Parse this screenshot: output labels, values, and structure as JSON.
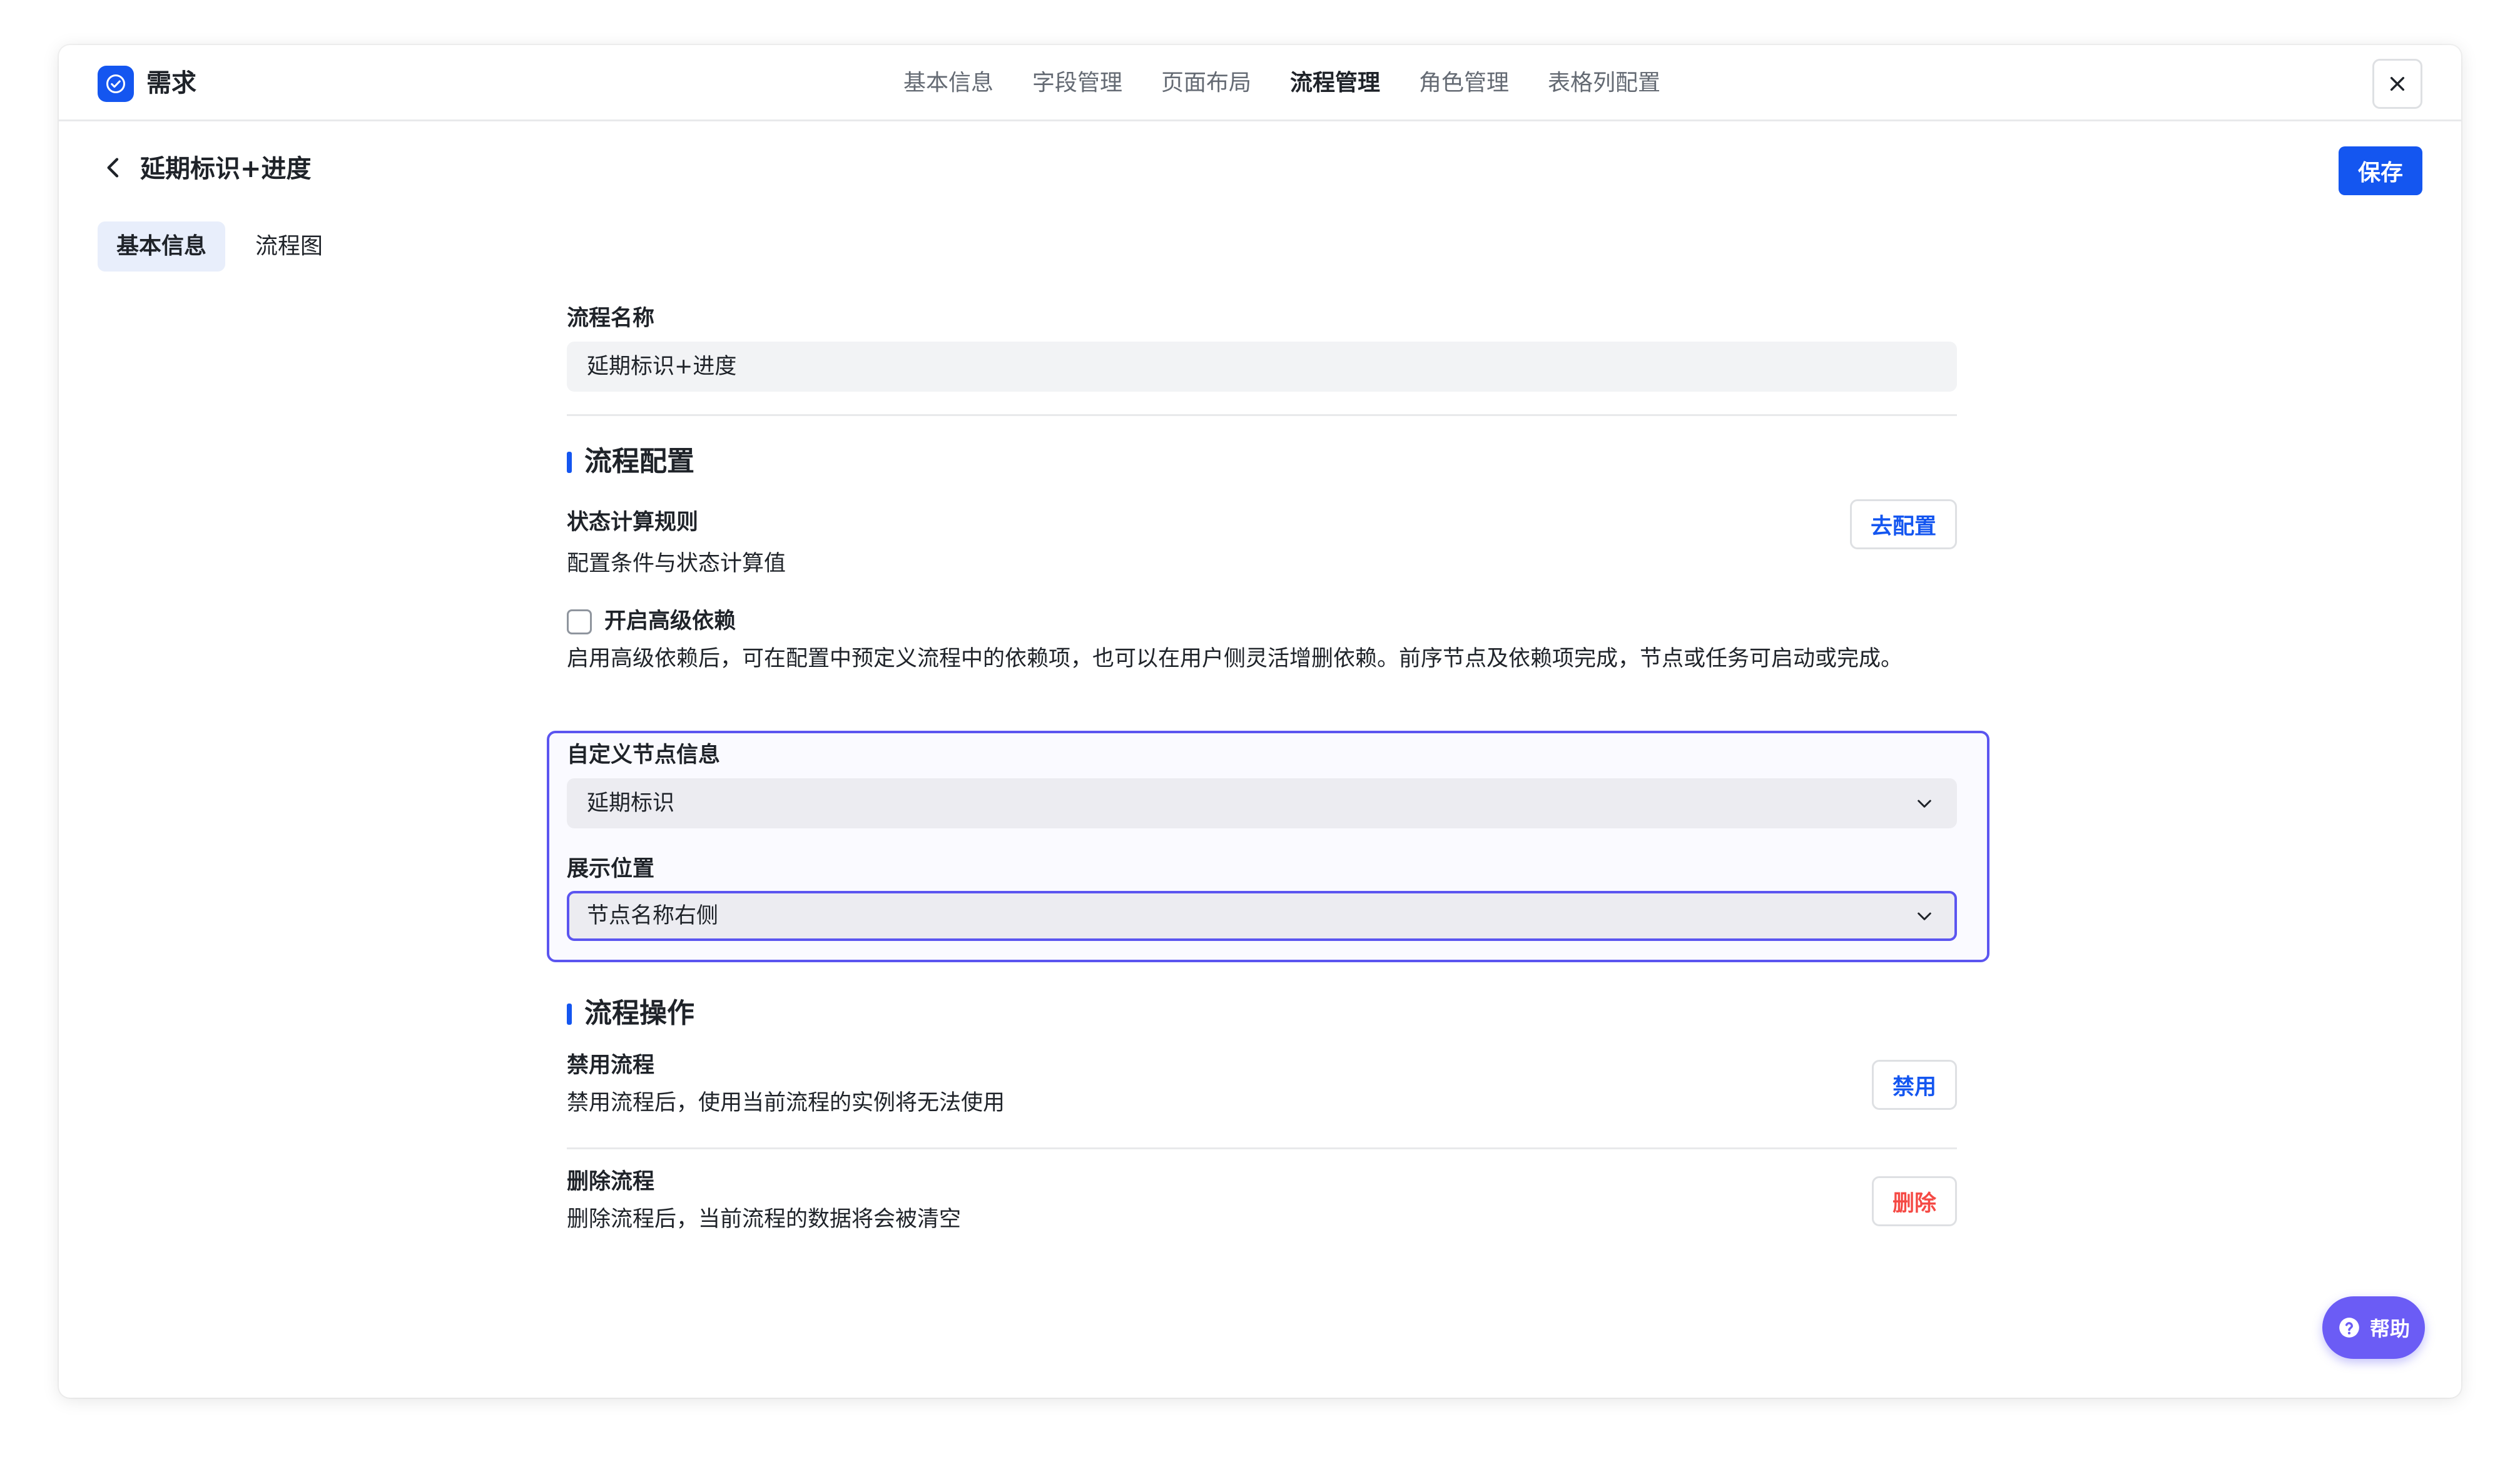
{
  "app": {
    "title": "需求"
  },
  "nav": {
    "tabs": [
      {
        "label": "基本信息",
        "active": false
      },
      {
        "label": "字段管理",
        "active": false
      },
      {
        "label": "页面布局",
        "active": false
      },
      {
        "label": "流程管理",
        "active": true
      },
      {
        "label": "角色管理",
        "active": false
      },
      {
        "label": "表格列配置",
        "active": false
      }
    ]
  },
  "header": {
    "title": "延期标识+进度",
    "save_label": "保存"
  },
  "sub_tabs": [
    {
      "label": "基本信息",
      "active": true
    },
    {
      "label": "流程图",
      "active": false
    }
  ],
  "form": {
    "flow_name_label": "流程名称",
    "flow_name_value": "延期标识+进度",
    "config_section": "流程配置",
    "state_rule_label": "状态计算规则",
    "state_rule_desc": "配置条件与状态计算值",
    "state_rule_button": "去配置",
    "advanced_dep_label": "开启高级依赖",
    "advanced_dep_checked": false,
    "advanced_dep_desc": "启用高级依赖后，可在配置中预定义流程中的依赖项，也可以在用户侧灵活增删依赖。前序节点及依赖项完成，节点或任务可启动或完成。",
    "custom_node_label": "自定义节点信息",
    "custom_node_value": "延期标识",
    "display_pos_label": "展示位置",
    "display_pos_value": "节点名称右侧",
    "ops_section": "流程操作",
    "disable_label": "禁用流程",
    "disable_desc": "禁用流程后，使用当前流程的实例将无法使用",
    "disable_button": "禁用",
    "delete_label": "删除流程",
    "delete_desc": "删除流程后，当前流程的数据将会被清空",
    "delete_button": "删除"
  },
  "help": {
    "label": "帮助"
  },
  "colors": {
    "primary": "#1456f0",
    "accent": "#5b55f0",
    "danger": "#f54a45",
    "help": "#6b5cf5"
  },
  "icons": [
    "check-circle-icon",
    "close-icon",
    "chevron-left-icon",
    "chevron-down-icon",
    "question-circle-icon"
  ]
}
